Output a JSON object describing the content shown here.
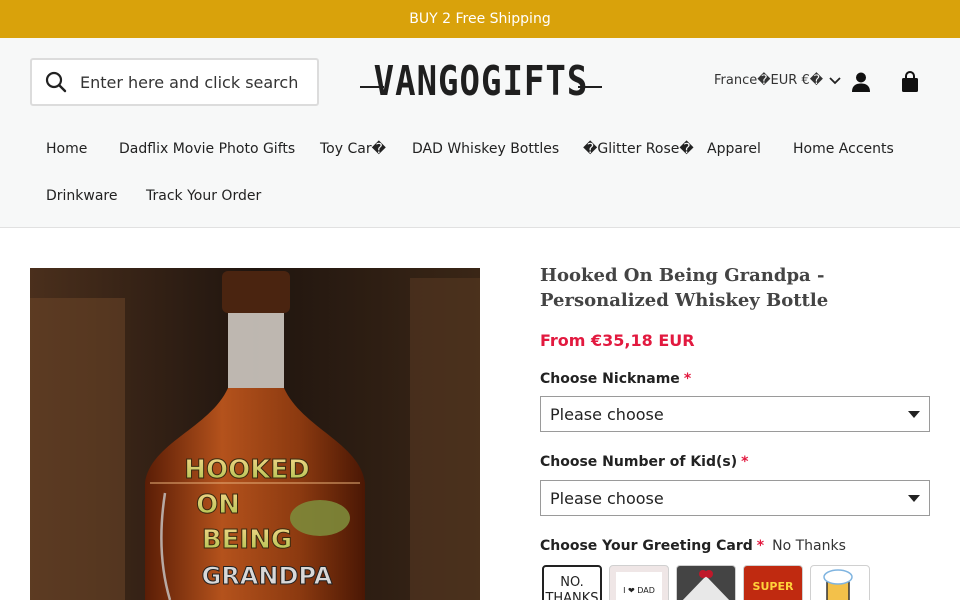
{
  "announcement": "BUY 2 Free Shipping",
  "header": {
    "search_placeholder": "Enter here and click search",
    "logo_text": "VANGOGIFTS",
    "locale": "France�EUR €�"
  },
  "nav": {
    "items": [
      "Home",
      "Dadflix Movie Photo Gifts",
      "Toy Car�",
      "DAD Whiskey Bottles",
      "�Glitter Rose�",
      "Apparel",
      "Home Accents",
      "Drinkware",
      "Track Your Order"
    ]
  },
  "product": {
    "title": "Hooked On Being Grandpa - Personalized Whiskey Bottle",
    "price": "From €35,18 EUR",
    "image_text": [
      "HOOKED",
      "ON",
      "BEING",
      "GRANDPA"
    ]
  },
  "options": {
    "required_mark": "*",
    "nickname_label": "Choose Nickname",
    "nickname_value": "Please choose",
    "kids_label": "Choose Number of Kid(s)",
    "kids_value": "Please choose",
    "card_label": "Choose Your Greeting Card",
    "card_value": "No Thanks",
    "card_swatches": [
      "NO. THANKS",
      "I ❤ DAD",
      "",
      "SUPER",
      ""
    ]
  },
  "colors": {
    "announcement_bg": "#d9a20b",
    "price": "#e2193f",
    "required": "#e2193f"
  },
  "icons": [
    "search-icon",
    "account-icon",
    "cart-icon",
    "chevron-down-icon"
  ]
}
